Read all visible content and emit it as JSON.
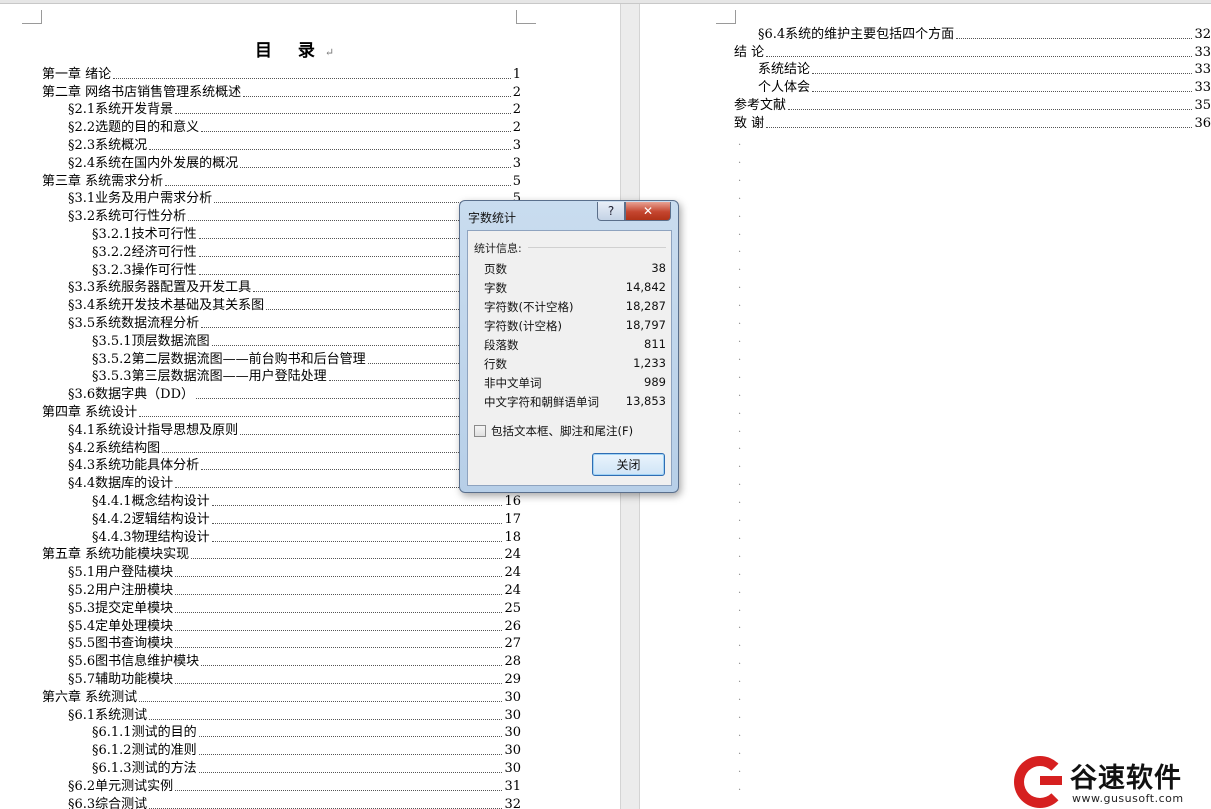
{
  "toc": {
    "title": "目 录",
    "paragraph_mark": "↵",
    "left": [
      {
        "text": "第一章  绪论",
        "page": "1"
      },
      {
        "text": "第二章  网络书店销售管理系统概述",
        "page": "2"
      },
      {
        "text": "§2.1系统开发背景",
        "page": "2"
      },
      {
        "text": "§2.2选题的目的和意义",
        "page": "2"
      },
      {
        "text": "§2.3系统概况",
        "page": "3"
      },
      {
        "text": "§2.4系统在国内外发展的概况",
        "page": "3"
      },
      {
        "text": "第三章  系统需求分析",
        "page": "5"
      },
      {
        "text": "§3.1业务及用户需求分析",
        "page": "5"
      },
      {
        "text": "§3.2系统可行性分析",
        "page": ""
      },
      {
        "text": "§3.2.1技术可行性",
        "page": ""
      },
      {
        "text": "§3.2.2经济可行性",
        "page": ""
      },
      {
        "text": "§3.2.3操作可行性",
        "page": ""
      },
      {
        "text": "§3.3系统服务器配置及开发工具",
        "page": ""
      },
      {
        "text": "§3.4系统开发技术基础及其关系图",
        "page": ""
      },
      {
        "text": "§3.5系统数据流程分析",
        "page": ""
      },
      {
        "text": "§3.5.1顶层数据流图",
        "page": ""
      },
      {
        "text": "§3.5.2第二层数据流图——前台购书和后台管理",
        "page": ""
      },
      {
        "text": "§3.5.3第三层数据流图——用户登陆处理",
        "page": ""
      },
      {
        "text": "§3.6数据字典（DD）",
        "page": ""
      },
      {
        "text": "第四章  系统设计",
        "page": ""
      },
      {
        "text": "§4.1系统设计指导思想及原则",
        "page": ""
      },
      {
        "text": "§4.2系统结构图",
        "page": ""
      },
      {
        "text": "§4.3系统功能具体分析",
        "page": ""
      },
      {
        "text": "§4.4数据库的设计",
        "page": ""
      },
      {
        "text": "§4.4.1概念结构设计",
        "page": "16"
      },
      {
        "text": "§4.4.2逻辑结构设计",
        "page": "17"
      },
      {
        "text": "§4.4.3物理结构设计",
        "page": "18"
      },
      {
        "text": "第五章  系统功能模块实现",
        "page": "24"
      },
      {
        "text": "§5.1用户登陆模块",
        "page": "24"
      },
      {
        "text": "§5.2用户注册模块",
        "page": "24"
      },
      {
        "text": "§5.3提交定单模块",
        "page": "25"
      },
      {
        "text": "§5.4定单处理模块",
        "page": "26"
      },
      {
        "text": "§5.5图书查询模块",
        "page": "27"
      },
      {
        "text": "§5.6图书信息维护模块",
        "page": "28"
      },
      {
        "text": "§5.7辅助功能模块",
        "page": "29"
      },
      {
        "text": "第六章  系统测试",
        "page": "30"
      },
      {
        "text": "§6.1系统测试",
        "page": "30"
      },
      {
        "text": "§6.1.1测试的目的",
        "page": "30"
      },
      {
        "text": "§6.1.2测试的准则",
        "page": "30"
      },
      {
        "text": "§6.1.3测试的方法",
        "page": "30"
      },
      {
        "text": "§6.2单元测试实例",
        "page": "31"
      },
      {
        "text": "§6.3综合测试",
        "page": "32"
      }
    ],
    "right": [
      {
        "text": "§6.4系统的维护主要包括四个方面",
        "page": "32"
      },
      {
        "text": "结    论",
        "page": "33"
      },
      {
        "text": "系统结论",
        "page": "33"
      },
      {
        "text": "个人体会",
        "page": "33"
      },
      {
        "text": "参考文献",
        "page": "35"
      },
      {
        "text": "致    谢",
        "page": "36"
      }
    ]
  },
  "dialog": {
    "title": "字数统计",
    "help_label": "?",
    "close_x_label": "✕",
    "section_label": "统计信息:",
    "stats": [
      {
        "label": "页数",
        "value": "38"
      },
      {
        "label": "字数",
        "value": "14,842"
      },
      {
        "label": "字符数(不计空格)",
        "value": "18,287"
      },
      {
        "label": "字符数(计空格)",
        "value": "18,797"
      },
      {
        "label": "段落数",
        "value": "811"
      },
      {
        "label": "行数",
        "value": "1,233"
      },
      {
        "label": "非中文单词",
        "value": "989"
      },
      {
        "label": "中文字符和朝鲜语单词",
        "value": "13,853"
      }
    ],
    "checkbox_label": "包括文本框、脚注和尾注(F)",
    "checkbox_checked": false,
    "close_button": "关闭"
  },
  "watermark": {
    "name": "谷速软件",
    "url": "www.gususoft.com",
    "accent": "#d62020"
  }
}
